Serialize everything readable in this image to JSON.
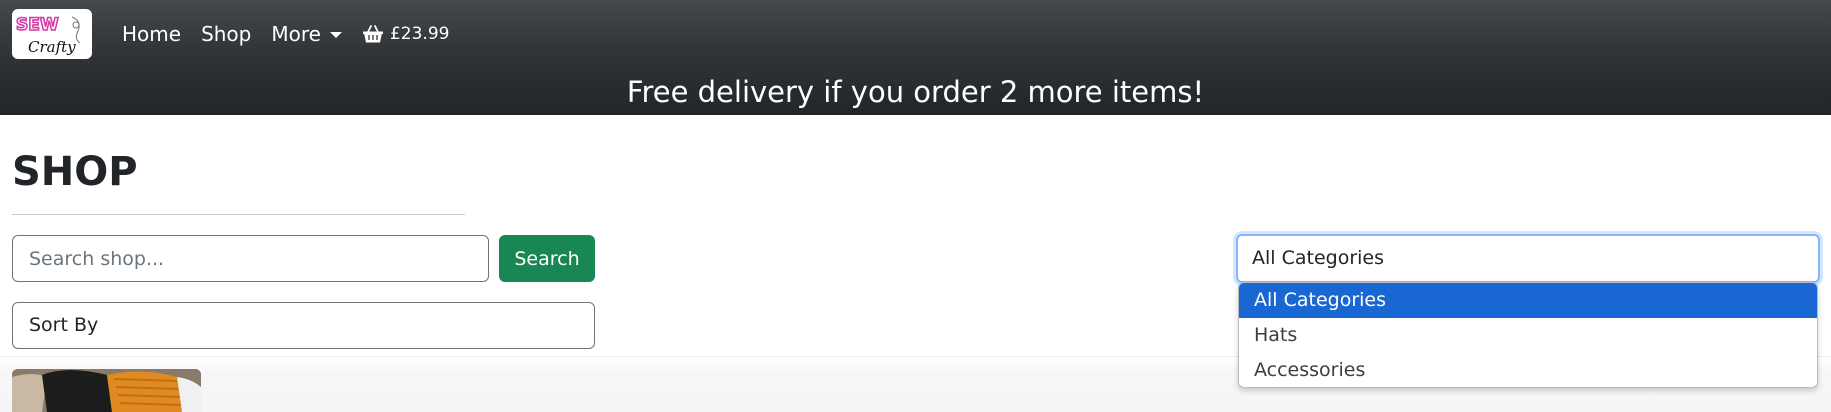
{
  "logo": {
    "line1": "SEW",
    "line2": "Crafty"
  },
  "nav": {
    "home": "Home",
    "shop": "Shop",
    "more": "More",
    "cart_total": "£23.99"
  },
  "banner": {
    "text": "Free delivery if you order 2 more items!"
  },
  "page": {
    "title": "SHOP"
  },
  "search": {
    "placeholder": "Search shop...",
    "value": "",
    "button_label": "Search"
  },
  "sort": {
    "selected": "Sort By"
  },
  "category": {
    "selected": "All Categories",
    "options": [
      "All Categories",
      "Hats",
      "Accessories"
    ]
  },
  "colors": {
    "navbar": "#212529",
    "search_button": "#198754",
    "selected_option": "#1967d2",
    "focus_border": "#86b7fe"
  },
  "icons": {
    "cart": "basket-icon",
    "more": "chevron-down-icon"
  }
}
